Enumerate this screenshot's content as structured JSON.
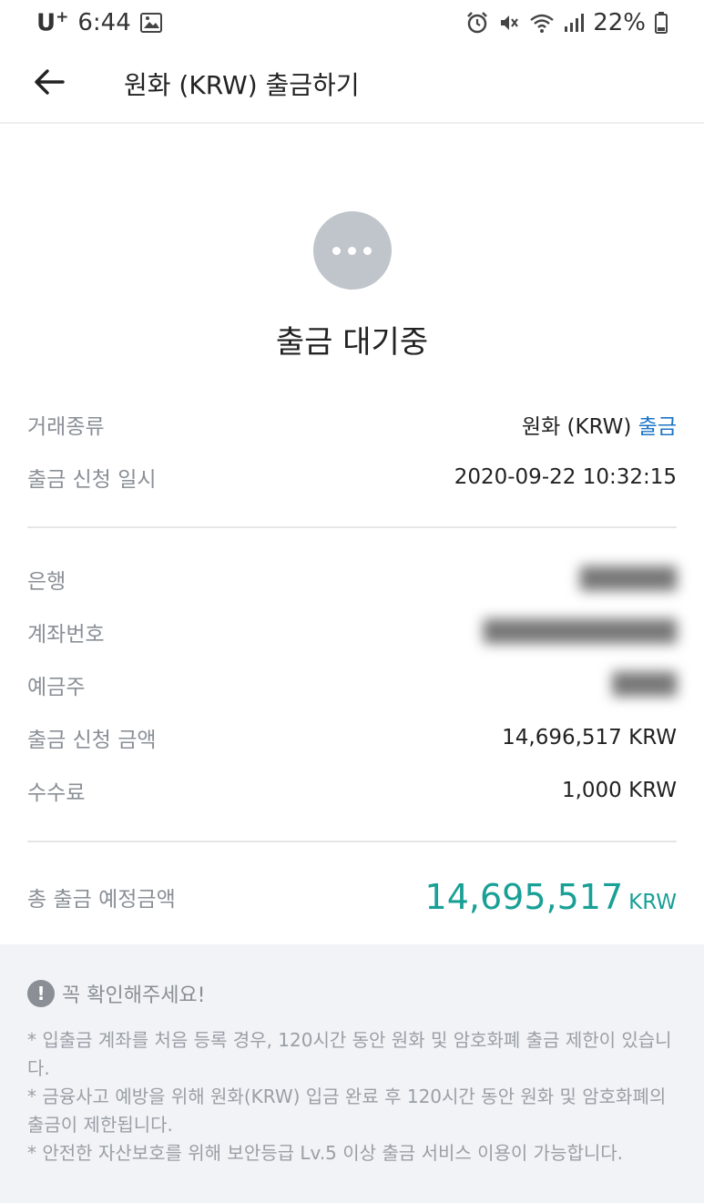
{
  "status_bar": {
    "carrier": "U",
    "carrier_sup": "+",
    "time": "6:44",
    "battery": "22%"
  },
  "header": {
    "title": "원화 (KRW) 출금하기",
    "back_icon": "arrow-left-icon"
  },
  "status": {
    "icon": "more-dots-icon",
    "title": "출금 대기중"
  },
  "transaction": {
    "type_label": "거래종류",
    "type_value": "원화 (KRW)",
    "type_accent": "출금",
    "requested_at_label": "출금 신청 일시",
    "requested_at_value": "2020-09-22 10:32:15"
  },
  "account": {
    "bank_label": "은행",
    "bank_value": "",
    "account_no_label": "계좌번호",
    "account_no_value": "",
    "holder_label": "예금주",
    "holder_value": "",
    "amount_label": "출금 신청 금액",
    "amount_value": "14,696,517 KRW",
    "fee_label": "수수료",
    "fee_value": "1,000 KRW"
  },
  "total": {
    "label": "총 출금 예정금액",
    "amount": "14,695,517",
    "unit": "KRW"
  },
  "notice": {
    "title": "꼭 확인해주세요!",
    "icon": "exclamation-icon",
    "lines": [
      "* 입출금 계좌를 처음 등록 경우, 120시간 동안 원화 및 암호화폐 출금 제한이 있습니다.",
      "* 금융사고 예방을 위해 원화(KRW) 입금 완료 후 120시간 동안 원화 및 암호화폐의 출금이 제한됩니다.",
      "* 안전한 자산보호를 위해 보안등급 Lv.5 이상 출금 서비스 이용이 가능합니다."
    ]
  },
  "colors": {
    "accent_blue": "#1b74c5",
    "total_teal": "#19a096",
    "pending_gray": "#c0c5cc"
  }
}
